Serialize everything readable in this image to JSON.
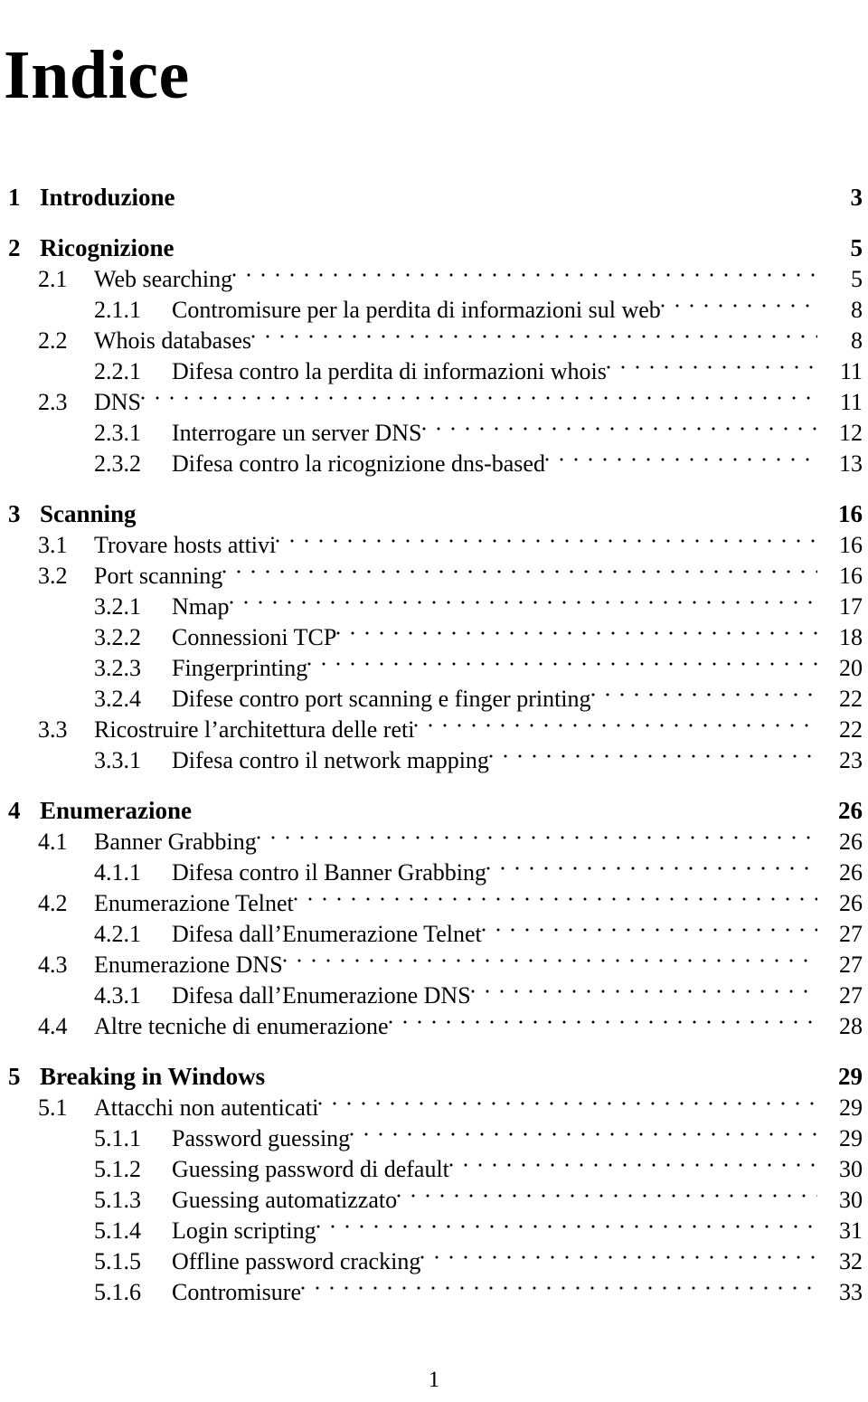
{
  "document": {
    "title": "Indice",
    "folio": "1"
  },
  "toc": {
    "entries": [
      {
        "level": 1,
        "number": "1",
        "label": "Introduzione",
        "page": "3",
        "leader": false
      },
      {
        "level": 1,
        "number": "2",
        "label": "Ricognizione",
        "page": "5",
        "leader": false
      },
      {
        "level": 2,
        "number": "2.1",
        "label": "Web searching",
        "page": "5",
        "leader": true
      },
      {
        "level": 3,
        "number": "2.1.1",
        "label": "Contromisure per la perdita di informazioni sul web",
        "page": "8",
        "leader": true
      },
      {
        "level": 2,
        "number": "2.2",
        "label": "Whois databases",
        "page": "8",
        "leader": true
      },
      {
        "level": 3,
        "number": "2.2.1",
        "label": "Difesa contro la perdita di informazioni whois",
        "page": "11",
        "leader": true
      },
      {
        "level": 2,
        "number": "2.3",
        "label": "DNS",
        "page": "11",
        "leader": true
      },
      {
        "level": 3,
        "number": "2.3.1",
        "label": "Interrogare un server DNS",
        "page": "12",
        "leader": true
      },
      {
        "level": 3,
        "number": "2.3.2",
        "label": "Difesa contro la ricognizione dns-based",
        "page": "13",
        "leader": true
      },
      {
        "level": 1,
        "number": "3",
        "label": "Scanning",
        "page": "16",
        "leader": false
      },
      {
        "level": 2,
        "number": "3.1",
        "label": "Trovare hosts attivi",
        "page": "16",
        "leader": true
      },
      {
        "level": 2,
        "number": "3.2",
        "label": "Port scanning",
        "page": "16",
        "leader": true
      },
      {
        "level": 3,
        "number": "3.2.1",
        "label": "Nmap",
        "page": "17",
        "leader": true
      },
      {
        "level": 3,
        "number": "3.2.2",
        "label": "Connessioni TCP",
        "page": "18",
        "leader": true
      },
      {
        "level": 3,
        "number": "3.2.3",
        "label": "Fingerprinting",
        "page": "20",
        "leader": true
      },
      {
        "level": 3,
        "number": "3.2.4",
        "label": "Difese contro port scanning e finger printing",
        "page": "22",
        "leader": true
      },
      {
        "level": 2,
        "number": "3.3",
        "label": "Ricostruire l’architettura delle reti",
        "page": "22",
        "leader": true
      },
      {
        "level": 3,
        "number": "3.3.1",
        "label": "Difesa contro il network mapping",
        "page": "23",
        "leader": true
      },
      {
        "level": 1,
        "number": "4",
        "label": "Enumerazione",
        "page": "26",
        "leader": false
      },
      {
        "level": 2,
        "number": "4.1",
        "label": "Banner Grabbing",
        "page": "26",
        "leader": true
      },
      {
        "level": 3,
        "number": "4.1.1",
        "label": "Difesa contro il Banner Grabbing",
        "page": "26",
        "leader": true
      },
      {
        "level": 2,
        "number": "4.2",
        "label": "Enumerazione Telnet",
        "page": "26",
        "leader": true
      },
      {
        "level": 3,
        "number": "4.2.1",
        "label": "Difesa dall’Enumerazione Telnet",
        "page": "27",
        "leader": true
      },
      {
        "level": 2,
        "number": "4.3",
        "label": "Enumerazione DNS",
        "page": "27",
        "leader": true
      },
      {
        "level": 3,
        "number": "4.3.1",
        "label": "Difesa dall’Enumerazione DNS",
        "page": "27",
        "leader": true
      },
      {
        "level": 2,
        "number": "4.4",
        "label": "Altre tecniche di enumerazione",
        "page": "28",
        "leader": true
      },
      {
        "level": 1,
        "number": "5",
        "label": "Breaking in Windows",
        "page": "29",
        "leader": false
      },
      {
        "level": 2,
        "number": "5.1",
        "label": "Attacchi non autenticati",
        "page": "29",
        "leader": true
      },
      {
        "level": 3,
        "number": "5.1.1",
        "label": "Password guessing",
        "page": "29",
        "leader": true
      },
      {
        "level": 3,
        "number": "5.1.2",
        "label": "Guessing password di default",
        "page": "30",
        "leader": true
      },
      {
        "level": 3,
        "number": "5.1.3",
        "label": "Guessing automatizzato",
        "page": "30",
        "leader": true
      },
      {
        "level": 3,
        "number": "5.1.4",
        "label": "Login scripting",
        "page": "31",
        "leader": true
      },
      {
        "level": 3,
        "number": "5.1.5",
        "label": "Offline password cracking",
        "page": "32",
        "leader": true
      },
      {
        "level": 3,
        "number": "5.1.6",
        "label": "Contromisure",
        "page": "33",
        "leader": true
      }
    ]
  }
}
